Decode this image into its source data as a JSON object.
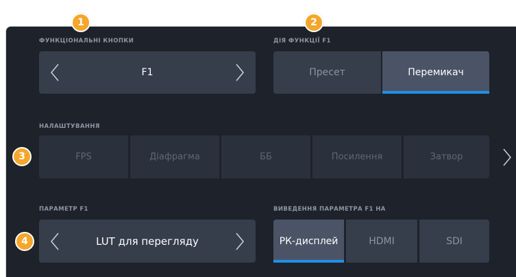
{
  "markers": [
    "1",
    "2",
    "3",
    "4"
  ],
  "function_buttons": {
    "label": "ФУНКЦІОНАЛЬНІ КНОПКИ",
    "value": "F1"
  },
  "f1_action": {
    "label": "ДІЯ ФУНКЦІЇ F1",
    "options": [
      "Пресет",
      "Перемикач"
    ],
    "selected": "Перемикач"
  },
  "settings": {
    "label": "НАЛАШТУВАННЯ",
    "items": [
      "FPS",
      "Діафрагма",
      "ББ",
      "Посилення",
      "Затвор"
    ]
  },
  "f1_parameter": {
    "label": "ПАРАМЕТР F1",
    "value": "LUT для перегляду"
  },
  "f1_output": {
    "label": "ВИВЕДЕННЯ ПАРАМЕТРА F1 НА",
    "options": [
      "РК-дисплей",
      "HDMI",
      "SDI"
    ],
    "selected": "РК-дисплей"
  },
  "colors": {
    "panel": "#1d222b",
    "tile": "#363e4b",
    "accent": "#1e90e8",
    "marker": "#f4a72c"
  },
  "icons": [
    "chevron-left-icon",
    "chevron-right-icon"
  ]
}
